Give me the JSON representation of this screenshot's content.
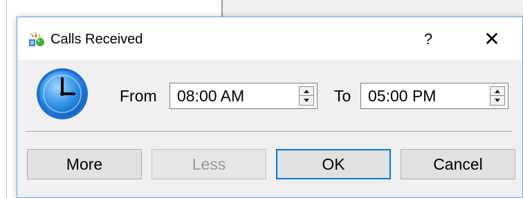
{
  "dialog": {
    "title": "Calls Received",
    "help_label": "?",
    "close_label": "✕"
  },
  "time_range": {
    "from_label": "From",
    "from_value": "08:00 AM",
    "to_label": "To",
    "to_value": "05:00 PM"
  },
  "buttons": {
    "more": "More",
    "less": "Less",
    "ok": "OK",
    "cancel": "Cancel"
  },
  "icons": {
    "title": "calls-app-icon",
    "clock": "clock-icon"
  },
  "colors": {
    "accent": "#0078d7",
    "dialog_border": "#6fa3d6",
    "disabled_text": "#9a9a9a"
  }
}
